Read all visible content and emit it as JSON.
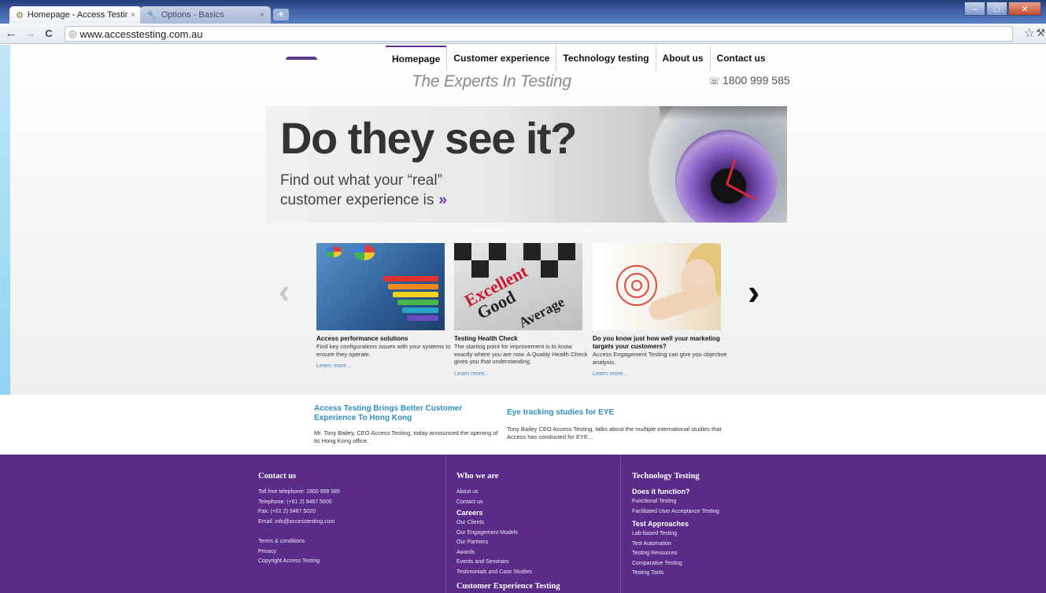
{
  "browser": {
    "tabs": [
      {
        "label": "Homepage - Access Testing",
        "close": "×",
        "icon": "gear-icon"
      },
      {
        "label": "Options - Basics",
        "close": "×",
        "icon": "wrench-icon"
      }
    ],
    "new_tab_glyph": "+",
    "url": "www.accesstesting.com.au",
    "nav": {
      "back": "←",
      "forward": "→",
      "reload": "C"
    }
  },
  "site": {
    "nav": [
      "Homepage",
      "Customer experience",
      "Technology testing",
      "About us",
      "Contact us"
    ],
    "tagline": "The Experts In Testing",
    "phone": "1800 999 585"
  },
  "hero": {
    "headline": "Do they see it?",
    "subline_1": "Find out what your “real”",
    "subline_2": "customer experience is",
    "arrows": "»"
  },
  "carousel": {
    "prev": "‹",
    "next": "›",
    "cards": [
      {
        "title": "Access performance solutions",
        "desc": "Find key configurations issues with your systems to ensure they operate.",
        "more": "Learn more..."
      },
      {
        "title": "Testing Health Check",
        "desc": "The starting point for improvement is to know exactly where you are now. A Quality Health Check gives you that understanding.",
        "more": "Learn more..."
      },
      {
        "title": "Do you know just how well your marketing targets your customers?",
        "desc": "Access Engagement Testing can give you objective analysis.",
        "more": "Learn more..."
      }
    ],
    "card2_words": [
      "Excellent",
      "Good",
      "Average"
    ]
  },
  "news": [
    {
      "title": "Access Testing Brings Better Customer Experience To Hong Kong",
      "desc": "Mr. Tony Bailey, CEO Access Testing, today announced the opening of its Hong Kong office."
    },
    {
      "title": "Eye tracking studies for EYE",
      "desc": "Tony Bailey CEO Access Testing, talks about the multiple international studies that Access has conducted for EYE..."
    }
  ],
  "footer": {
    "contact": {
      "heading": "Contact us",
      "lines": [
        "Toll free telephone: 1800 999 585",
        "Telephone: (+61 2) 9487 5000",
        "Fax: (+61 2) 9487 5020",
        "Email: info@accesstesting.com"
      ],
      "legal": [
        "Terms & conditions",
        "Privacy",
        "Copyright Access Testing"
      ]
    },
    "who": {
      "heading": "Who we are",
      "links_a": [
        "About us",
        "Contact us"
      ],
      "careers": "Careers",
      "links_b": [
        "Our Clients",
        "Our Engagement Models",
        "Our Partners",
        "Awards",
        "Events and Seminars",
        "Testimonials and Case Studies"
      ],
      "cx_heading": "Customer Experience Testing"
    },
    "tech": {
      "heading": "Technology Testing",
      "sub1": "Does it function?",
      "links1": [
        "Functional Testing",
        "Facilitated User Acceptance Testing"
      ],
      "sub2": "Test Approaches",
      "links2": [
        "Lab-based Testing",
        "Test Automation",
        "Testing Resources",
        "Comparative Testing",
        "Testing Tools"
      ]
    }
  }
}
